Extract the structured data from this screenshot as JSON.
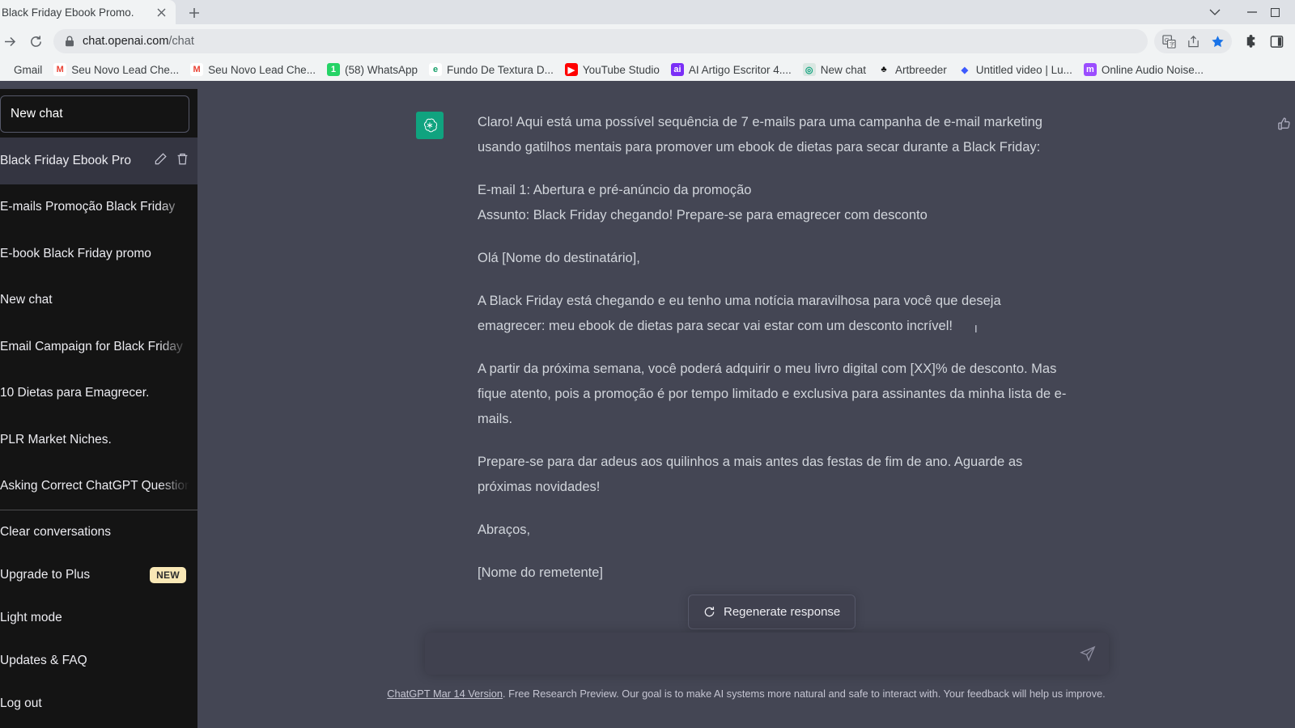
{
  "browser": {
    "tab": {
      "title": "Black Friday Ebook Promo.",
      "close_icon": "close-icon"
    },
    "newtab_label": "+",
    "window_controls": [
      {
        "name": "chevron-down-icon",
        "glyph": "⌄"
      },
      {
        "name": "minimize-icon",
        "glyph": "—"
      },
      {
        "name": "maximize-icon",
        "glyph": "▢"
      }
    ],
    "nav": {
      "forward_icon": "arrow-forward-icon",
      "reload_icon": "reload-icon"
    },
    "omnibox": {
      "lock_icon": "lock-icon",
      "domain": "chat.openai.com",
      "path": "/chat"
    },
    "toolbar_icons": [
      {
        "name": "translate-icon",
        "glyph": "G"
      },
      {
        "name": "share-icon",
        "glyph": "↱"
      },
      {
        "name": "bookmark-star-icon",
        "glyph": "★",
        "color": "#1a73e8"
      },
      {
        "name": "extensions-puzzle-icon",
        "glyph": "🧩"
      },
      {
        "name": "side-panel-icon",
        "glyph": "▯"
      }
    ],
    "bookmarks": [
      {
        "label": "Gmail",
        "icon": "gmail-icon",
        "icon_glyph": "",
        "bg": "transparent",
        "fg": "#ea4335"
      },
      {
        "label": "Seu Novo Lead Che...",
        "icon": "gmail-icon",
        "icon_glyph": "M",
        "bg": "#ffffff",
        "fg": "#ea4335"
      },
      {
        "label": "Seu Novo Lead Che...",
        "icon": "gmail-icon",
        "icon_glyph": "M",
        "bg": "#ffffff",
        "fg": "#ea4335"
      },
      {
        "label": "(58) WhatsApp",
        "icon": "whatsapp-icon",
        "icon_glyph": "1",
        "bg": "#25d366",
        "fg": "#ffffff"
      },
      {
        "label": "Fundo De Textura D...",
        "icon": "envato-icon",
        "icon_glyph": "e",
        "bg": "#ffffff",
        "fg": "#18a06b"
      },
      {
        "label": "YouTube Studio",
        "icon": "youtube-icon",
        "icon_glyph": "▶",
        "bg": "#ff0000",
        "fg": "#ffffff"
      },
      {
        "label": "AI Artigo Escritor 4....",
        "icon": "ai-writer-icon",
        "icon_glyph": "ai",
        "bg": "#7b2ff7",
        "fg": "#ffffff"
      },
      {
        "label": "New chat",
        "icon": "openai-icon",
        "icon_glyph": "◎",
        "bg": "#d9e7e2",
        "fg": "#10a37f"
      },
      {
        "label": "Artbreeder",
        "icon": "artbreeder-icon",
        "icon_glyph": "♣",
        "bg": "transparent",
        "fg": "#111111"
      },
      {
        "label": "Untitled video | Lu...",
        "icon": "lumen5-icon",
        "icon_glyph": "◆",
        "bg": "transparent",
        "fg": "#3d5afe"
      },
      {
        "label": "Online Audio Noise...",
        "icon": "media-io-icon",
        "icon_glyph": "m",
        "bg": "#9b4dff",
        "fg": "#ffffff"
      }
    ]
  },
  "sidebar": {
    "new_chat": {
      "label": "New chat",
      "icon": "plus-icon"
    },
    "conversations": [
      {
        "label": "Black Friday Ebook Pro",
        "active": true,
        "edit_icon": "pencil-icon",
        "delete_icon": "trash-icon"
      },
      {
        "label": "E-mails Promoção Black Friday",
        "active": false
      },
      {
        "label": "E-book Black Friday promo",
        "active": false
      },
      {
        "label": "New chat",
        "active": false
      },
      {
        "label": "Email Campaign for Black Friday",
        "active": false
      },
      {
        "label": "10 Dietas para Emagrecer.",
        "active": false
      },
      {
        "label": "PLR Market Niches.",
        "active": false
      },
      {
        "label": "Asking Correct ChatGPT Questions",
        "active": false
      }
    ],
    "menu": [
      {
        "label": "Clear conversations",
        "icon": "trash-icon",
        "badge": ""
      },
      {
        "label": "Upgrade to Plus",
        "icon": "upgrade-icon",
        "badge": "NEW"
      },
      {
        "label": "Light mode",
        "icon": "sun-icon",
        "badge": ""
      },
      {
        "label": "Updates & FAQ",
        "icon": "external-link-icon",
        "badge": ""
      },
      {
        "label": "Log out",
        "icon": "logout-icon",
        "badge": ""
      }
    ]
  },
  "chat": {
    "avatar_icon": "openai-logo-icon",
    "feedback": {
      "thumbs_up_icon": "thumbs-up-icon",
      "thumbs_down_icon": "thumbs-down-icon"
    },
    "paragraphs": [
      "Claro! Aqui está uma possível sequência de 7 e-mails para uma campanha de e-mail marketing usando gatilhos mentais para promover um ebook de dietas para secar durante a Black Friday:",
      "E-mail 1: Abertura e pré-anúncio da promoção\nAssunto: Black Friday chegando! Prepare-se para emagrecer com desconto",
      "Olá [Nome do destinatário],",
      "A Black Friday está chegando e eu tenho uma notícia maravilhosa para você que deseja emagrecer: meu ebook de dietas para secar vai estar com um desconto incrível!",
      "A partir da próxima semana, você poderá adquirir o meu livro digital com [XX]% de desconto. Mas fique atento, pois a promoção é por tempo limitado e exclusiva para assinantes da minha lista de e-mails.",
      "Prepare-se para dar adeus aos quilinhos a mais antes das festas de fim de ano. Aguarde as próximas novidades!",
      "Abraços,",
      "[Nome do remetente]"
    ]
  },
  "actions": {
    "regenerate_label": "Regenerate response",
    "regenerate_icon": "refresh-icon",
    "send_icon": "send-icon",
    "composer_placeholder": "",
    "composer_value": ""
  },
  "footer": {
    "link_text": "ChatGPT Mar 14 Version",
    "rest_text": ". Free Research Preview. Our goal is to make AI systems more natural and safe to interact with. Your feedback will help us improve."
  },
  "colors": {
    "accent": "#10a37f",
    "sidebar_bg": "#141414",
    "main_bg": "#444654",
    "active_item": "#343541",
    "badge_new": "#f9e8b6",
    "star_blue": "#1a73e8"
  }
}
